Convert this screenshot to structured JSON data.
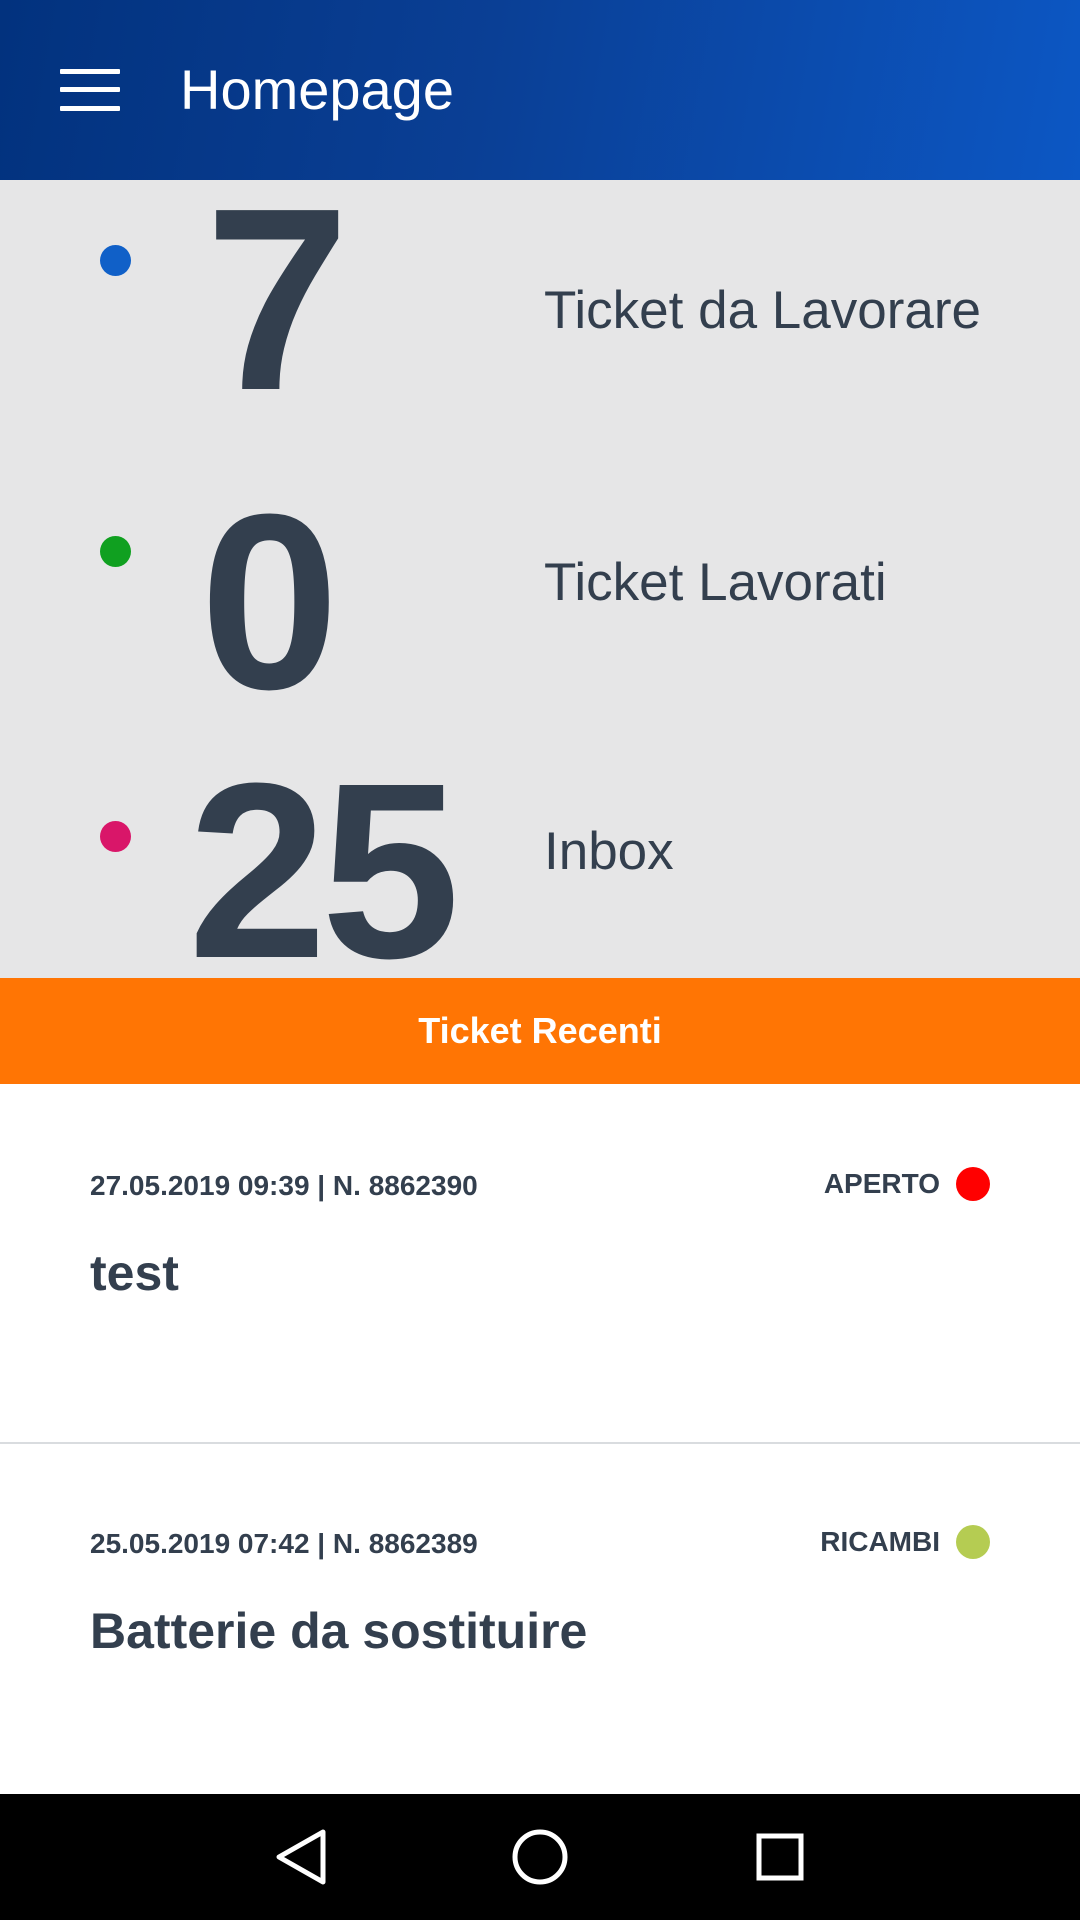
{
  "app_bar": {
    "title": "Homepage",
    "menu_icon": "hamburger-icon"
  },
  "stats": [
    {
      "count": "7",
      "label": "Ticket da Lavorare",
      "dot_color": "#1060c8"
    },
    {
      "count": "0",
      "label": "Ticket Lavorati",
      "dot_color": "#10a020"
    },
    {
      "count": "25",
      "label": "Inbox",
      "dot_color": "#d91669"
    }
  ],
  "recent": {
    "header": "Ticket Recenti",
    "header_color": "#ff7504",
    "tickets": [
      {
        "meta": "27.05.2019 09:39 | N. 8862390",
        "status": "APERTO",
        "status_color": "#ff0000",
        "title": "test"
      },
      {
        "meta": "25.05.2019 07:42 | N. 8862389",
        "status": "RICAMBI",
        "status_color": "#b5cc52",
        "title": "Batterie da sostituire"
      }
    ]
  },
  "nav": {
    "back_icon": "back-triangle-icon",
    "home_icon": "home-circle-icon",
    "recents_icon": "recents-square-icon"
  }
}
